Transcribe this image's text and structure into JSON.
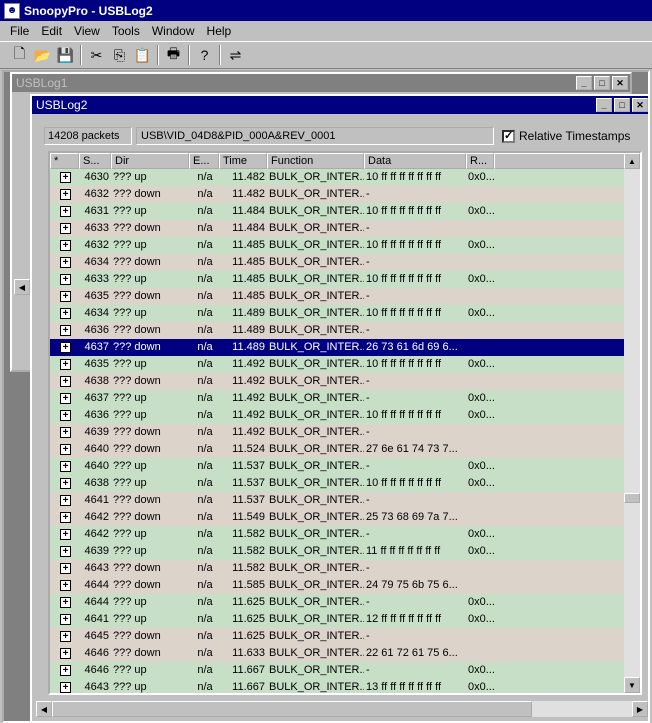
{
  "app": {
    "title": "SnoopyPro - USBLog2"
  },
  "menu": [
    "File",
    "Edit",
    "View",
    "Tools",
    "Window",
    "Help"
  ],
  "toolbar": {
    "icons": [
      "new-icon",
      "open-icon",
      "save-icon",
      "cut-icon",
      "copy-icon",
      "paste-icon",
      "print-icon",
      "help-icon",
      "usb-icon"
    ]
  },
  "windows": {
    "log1": {
      "title": "USBLog1"
    },
    "log2": {
      "title": "USBLog2"
    }
  },
  "info": {
    "packets": "14208 packets",
    "device": "USB\\VID_04D8&PID_000A&REV_0001",
    "relative_timestamps": "Relative Timestamps",
    "relative_checked": true
  },
  "columns": [
    "*",
    "S...",
    "Dir",
    "E...",
    "Time",
    "Function",
    "Data",
    "R..."
  ],
  "rows": [
    {
      "seq": "4630",
      "dir": "??? up",
      "e": "n/a",
      "time": "11.482",
      "fn": "BULK_OR_INTER...",
      "data": "10 ff ff ff ff ff ff ff",
      "r": "0x0..."
    },
    {
      "seq": "4632",
      "dir": "??? down",
      "e": "n/a",
      "time": "11.482",
      "fn": "BULK_OR_INTER...",
      "data": "-",
      "r": ""
    },
    {
      "seq": "4631",
      "dir": "??? up",
      "e": "n/a",
      "time": "11.484",
      "fn": "BULK_OR_INTER...",
      "data": "10 ff ff ff ff ff ff ff",
      "r": "0x0..."
    },
    {
      "seq": "4633",
      "dir": "??? down",
      "e": "n/a",
      "time": "11.484",
      "fn": "BULK_OR_INTER...",
      "data": "-",
      "r": ""
    },
    {
      "seq": "4632",
      "dir": "??? up",
      "e": "n/a",
      "time": "11.485",
      "fn": "BULK_OR_INTER...",
      "data": "10 ff ff ff ff ff ff ff",
      "r": "0x0..."
    },
    {
      "seq": "4634",
      "dir": "??? down",
      "e": "n/a",
      "time": "11.485",
      "fn": "BULK_OR_INTER...",
      "data": "-",
      "r": ""
    },
    {
      "seq": "4633",
      "dir": "??? up",
      "e": "n/a",
      "time": "11.485",
      "fn": "BULK_OR_INTER...",
      "data": "10 ff ff ff ff ff ff ff",
      "r": "0x0..."
    },
    {
      "seq": "4635",
      "dir": "??? down",
      "e": "n/a",
      "time": "11.485",
      "fn": "BULK_OR_INTER...",
      "data": "-",
      "r": ""
    },
    {
      "seq": "4634",
      "dir": "??? up",
      "e": "n/a",
      "time": "11.489",
      "fn": "BULK_OR_INTER...",
      "data": "10 ff ff ff ff ff ff ff",
      "r": "0x0..."
    },
    {
      "seq": "4636",
      "dir": "??? down",
      "e": "n/a",
      "time": "11.489",
      "fn": "BULK_OR_INTER...",
      "data": "-",
      "r": ""
    },
    {
      "seq": "4637",
      "dir": "??? down",
      "e": "n/a",
      "time": "11.489",
      "fn": "BULK_OR_INTER...",
      "data": "26 73 61 6d 69 6...",
      "r": "",
      "sel": true
    },
    {
      "seq": "4635",
      "dir": "??? up",
      "e": "n/a",
      "time": "11.492",
      "fn": "BULK_OR_INTER...",
      "data": "10 ff ff ff ff ff ff ff",
      "r": "0x0..."
    },
    {
      "seq": "4638",
      "dir": "??? down",
      "e": "n/a",
      "time": "11.492",
      "fn": "BULK_OR_INTER...",
      "data": "-",
      "r": ""
    },
    {
      "seq": "4637",
      "dir": "??? up",
      "e": "n/a",
      "time": "11.492",
      "fn": "BULK_OR_INTER...",
      "data": "-",
      "r": "0x0..."
    },
    {
      "seq": "4636",
      "dir": "??? up",
      "e": "n/a",
      "time": "11.492",
      "fn": "BULK_OR_INTER...",
      "data": "10 ff ff ff ff ff ff ff",
      "r": "0x0..."
    },
    {
      "seq": "4639",
      "dir": "??? down",
      "e": "n/a",
      "time": "11.492",
      "fn": "BULK_OR_INTER...",
      "data": "-",
      "r": ""
    },
    {
      "seq": "4640",
      "dir": "??? down",
      "e": "n/a",
      "time": "11.524",
      "fn": "BULK_OR_INTER...",
      "data": "27 6e 61 74 73 7...",
      "r": ""
    },
    {
      "seq": "4640",
      "dir": "??? up",
      "e": "n/a",
      "time": "11.537",
      "fn": "BULK_OR_INTER...",
      "data": "-",
      "r": "0x0..."
    },
    {
      "seq": "4638",
      "dir": "??? up",
      "e": "n/a",
      "time": "11.537",
      "fn": "BULK_OR_INTER...",
      "data": "10 ff ff ff ff ff ff ff",
      "r": "0x0..."
    },
    {
      "seq": "4641",
      "dir": "??? down",
      "e": "n/a",
      "time": "11.537",
      "fn": "BULK_OR_INTER...",
      "data": "-",
      "r": ""
    },
    {
      "seq": "4642",
      "dir": "??? down",
      "e": "n/a",
      "time": "11.549",
      "fn": "BULK_OR_INTER...",
      "data": "25 73 68 69 7a 7...",
      "r": ""
    },
    {
      "seq": "4642",
      "dir": "??? up",
      "e": "n/a",
      "time": "11.582",
      "fn": "BULK_OR_INTER...",
      "data": "-",
      "r": "0x0..."
    },
    {
      "seq": "4639",
      "dir": "??? up",
      "e": "n/a",
      "time": "11.582",
      "fn": "BULK_OR_INTER...",
      "data": "11 ff ff ff ff ff ff ff",
      "r": "0x0..."
    },
    {
      "seq": "4643",
      "dir": "??? down",
      "e": "n/a",
      "time": "11.582",
      "fn": "BULK_OR_INTER...",
      "data": "-",
      "r": ""
    },
    {
      "seq": "4644",
      "dir": "??? down",
      "e": "n/a",
      "time": "11.585",
      "fn": "BULK_OR_INTER...",
      "data": "24 79 75 6b 75 6...",
      "r": ""
    },
    {
      "seq": "4644",
      "dir": "??? up",
      "e": "n/a",
      "time": "11.625",
      "fn": "BULK_OR_INTER...",
      "data": "-",
      "r": "0x0..."
    },
    {
      "seq": "4641",
      "dir": "??? up",
      "e": "n/a",
      "time": "11.625",
      "fn": "BULK_OR_INTER...",
      "data": "12 ff ff ff ff ff ff ff",
      "r": "0x0..."
    },
    {
      "seq": "4645",
      "dir": "??? down",
      "e": "n/a",
      "time": "11.625",
      "fn": "BULK_OR_INTER...",
      "data": "-",
      "r": ""
    },
    {
      "seq": "4646",
      "dir": "??? down",
      "e": "n/a",
      "time": "11.633",
      "fn": "BULK_OR_INTER...",
      "data": "22 61 72 61 75 6...",
      "r": ""
    },
    {
      "seq": "4646",
      "dir": "??? up",
      "e": "n/a",
      "time": "11.667",
      "fn": "BULK_OR_INTER...",
      "data": "-",
      "r": "0x0..."
    },
    {
      "seq": "4643",
      "dir": "??? up",
      "e": "n/a",
      "time": "11.667",
      "fn": "BULK_OR_INTER...",
      "data": "13 ff ff ff ff ff ff ff",
      "r": "0x0..."
    }
  ]
}
